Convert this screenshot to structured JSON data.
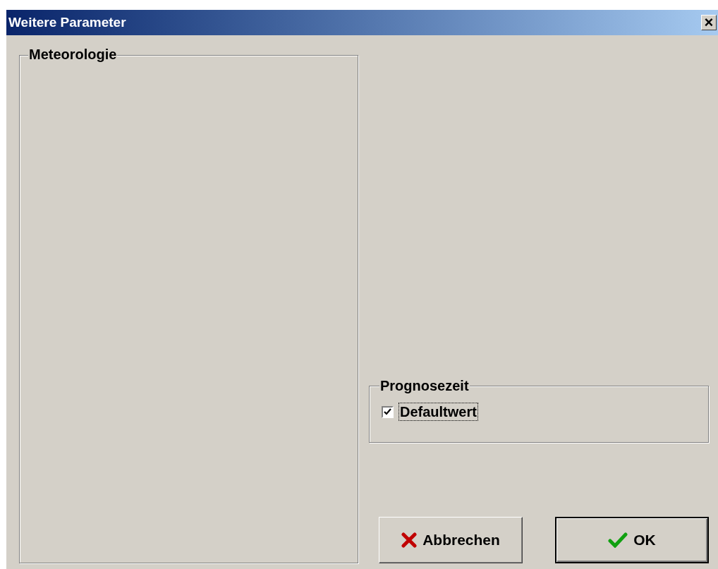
{
  "window": {
    "title": "Weitere Parameter",
    "close": "×"
  },
  "groups": [
    {
      "title": "Meteorologie"
    },
    {
      "title": "Prognosezeit",
      "checkbox": {
        "label": "Defaultwert",
        "checked": true,
        "focused": true
      }
    }
  ],
  "buttons": [
    {
      "label": "Abbrechen",
      "kind": "cancel",
      "default": false
    },
    {
      "label": "OK",
      "kind": "ok",
      "default": true
    }
  ]
}
